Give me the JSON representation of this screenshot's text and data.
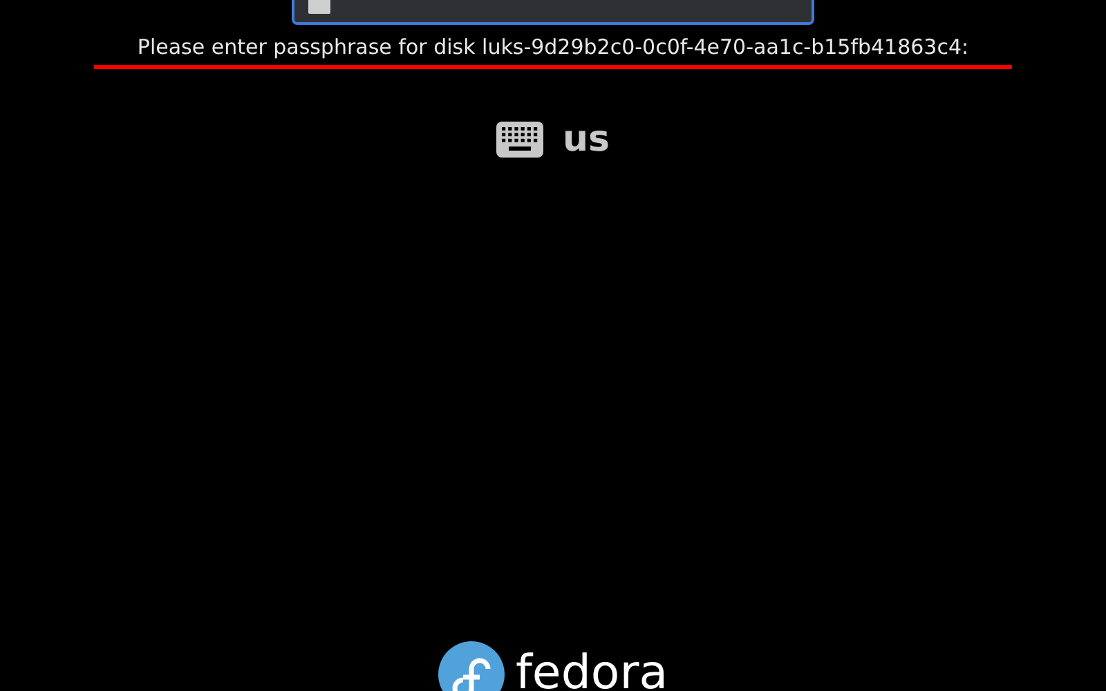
{
  "prompt": {
    "text": "Please enter passphrase for disk luks-9d29b2c0-0c0f-4e70-aa1c-b15fb41863c4:"
  },
  "keyboard": {
    "layout": "us"
  },
  "logo": {
    "wordmark": "fedora"
  }
}
